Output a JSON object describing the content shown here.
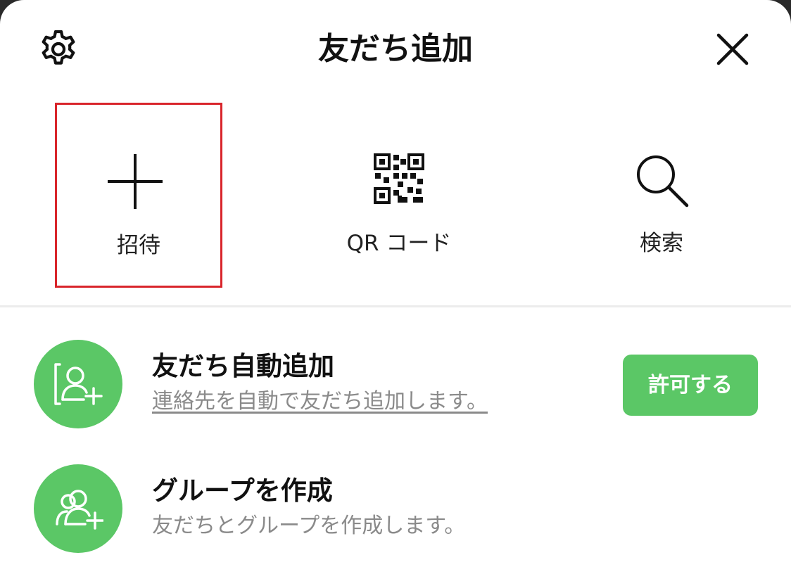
{
  "header": {
    "title": "友だち追加",
    "settings_icon": "gear-icon",
    "close_icon": "close-icon"
  },
  "actions": [
    {
      "label": "招待",
      "icon": "plus-icon",
      "highlighted": true,
      "highlight_color": "#d9252b"
    },
    {
      "label": "QR コード",
      "icon": "qr-code-icon"
    },
    {
      "label": "検索",
      "icon": "search-icon"
    }
  ],
  "rows": [
    {
      "title": "友だち自動追加",
      "subtitle": "連絡先を自動で友だち追加します。",
      "icon": "contacts-add-icon",
      "button_label": "許可する"
    },
    {
      "title": "グループを作成",
      "subtitle": "友だちとグループを作成します。",
      "icon": "group-add-icon"
    }
  ],
  "colors": {
    "accent": "#5bc766",
    "highlight": "#d9252b",
    "text": "#111111",
    "subtext": "#8a8a8a"
  }
}
